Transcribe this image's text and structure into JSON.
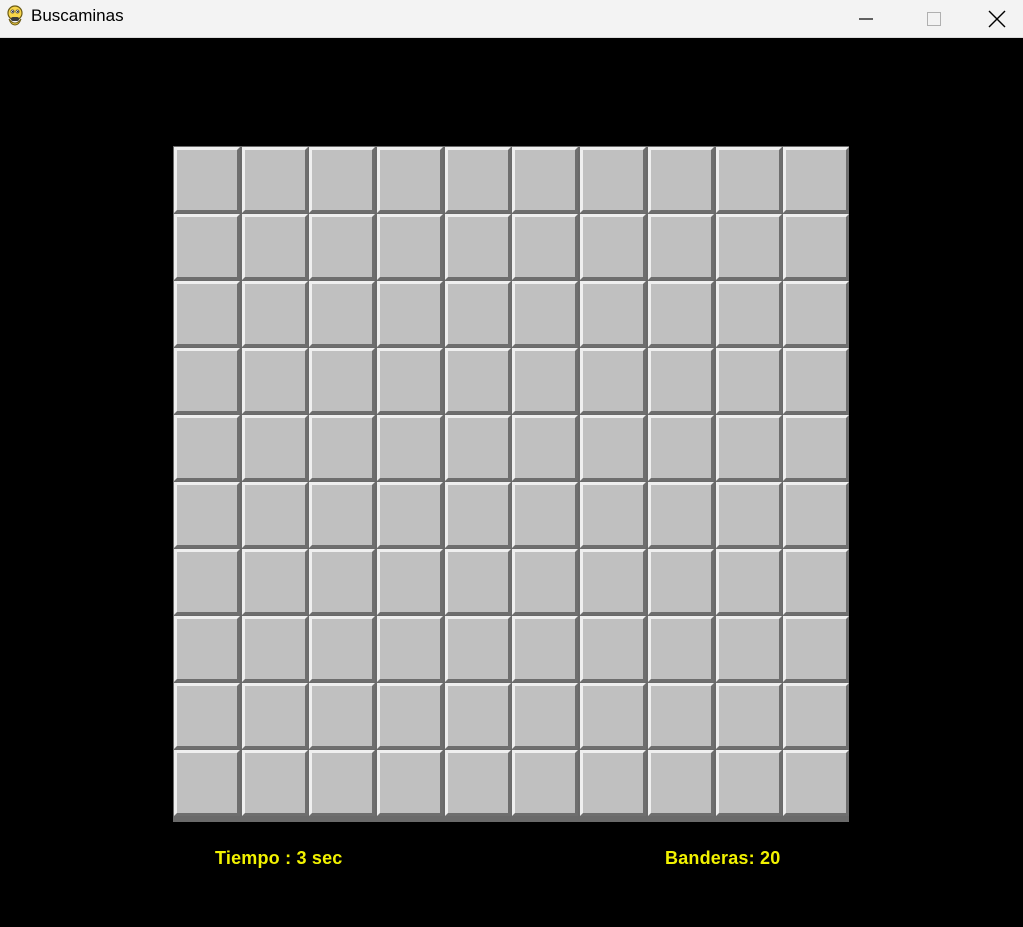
{
  "window": {
    "title": "Buscaminas",
    "icon": "python-snake-icon",
    "controls": [
      "minimize-icon",
      "maximize-icon",
      "close-icon"
    ]
  },
  "board": {
    "rows": 10,
    "cols": 10,
    "state": "all-covered",
    "cell_color": "#c0c0c0"
  },
  "status": {
    "time_label": "Tiempo : 3 sec",
    "flags_label": "Banderas: 20"
  },
  "colors": {
    "background": "#000000",
    "status_text": "#f2f200"
  }
}
